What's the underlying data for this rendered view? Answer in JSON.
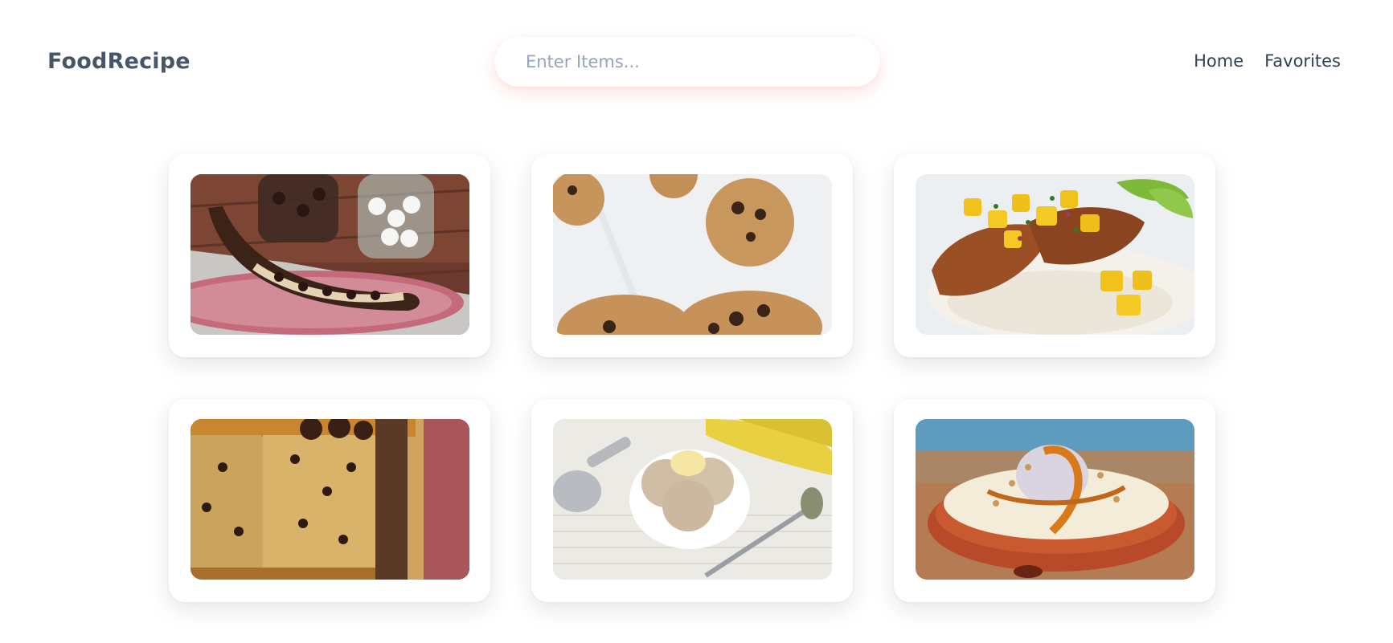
{
  "header": {
    "logo": "FoodRecipe",
    "search": {
      "placeholder": "Enter Items...",
      "value": ""
    },
    "nav": [
      {
        "label": "Home"
      },
      {
        "label": "Favorites"
      }
    ]
  },
  "recipes": [
    {
      "image": "banana-boat-chocolate-marshmallow-photo"
    },
    {
      "image": "oatmeal-chocolate-chip-cookies-photo"
    },
    {
      "image": "grilled-fish-mango-salsa-rice-photo"
    },
    {
      "image": "chocolate-chip-banana-cake-photo"
    },
    {
      "image": "banana-ice-cream-bowl-photo"
    },
    {
      "image": "caramel-cream-pie-photo"
    }
  ]
}
